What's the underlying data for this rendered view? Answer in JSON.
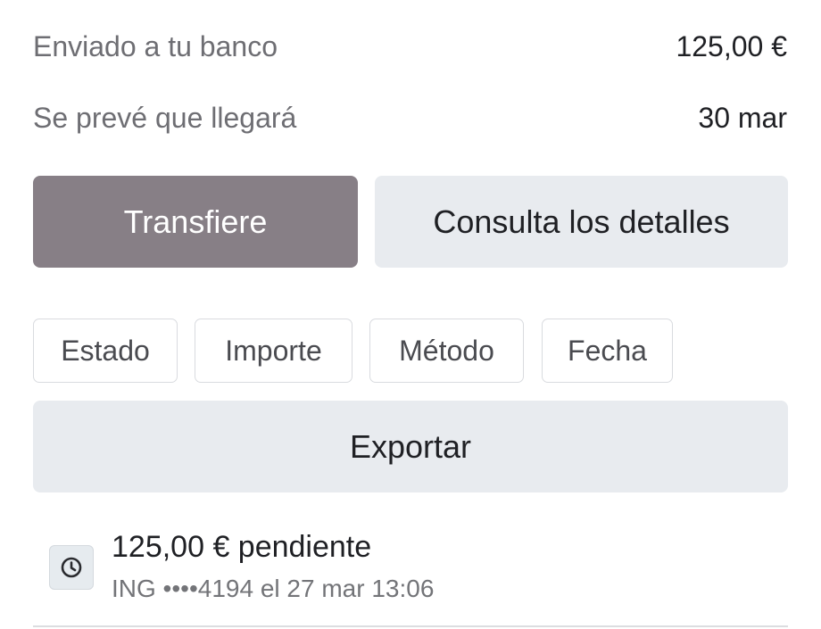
{
  "summary": {
    "sent_label": "Enviado a tu banco",
    "sent_value": "125,00 €",
    "eta_label": "Se prevé que llegará",
    "eta_value": "30 mar"
  },
  "actions": {
    "transfer_label": "Transfiere",
    "details_label": "Consulta los detalles"
  },
  "filters": {
    "status_label": "Estado",
    "amount_label": "Importe",
    "method_label": "Método",
    "date_label": "Fecha"
  },
  "export": {
    "label": "Exportar"
  },
  "payouts": [
    {
      "icon": "clock-icon",
      "title": "125,00 € pendiente",
      "subtitle": "ING ••••4194 el 27 mar 13:06"
    }
  ],
  "colors": {
    "primary_button": "#877f86",
    "secondary_button": "#e8ebef"
  }
}
